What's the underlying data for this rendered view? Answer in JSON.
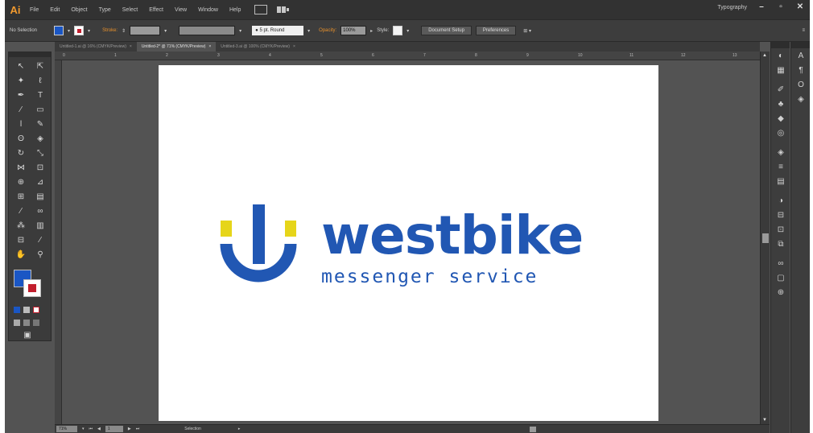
{
  "app": {
    "logo": "Ai"
  },
  "menu": [
    "File",
    "Edit",
    "Object",
    "Type",
    "Select",
    "Effect",
    "View",
    "Window",
    "Help"
  ],
  "workspace": "Typography",
  "window_buttons": {
    "minimize": "–",
    "restore": "▫",
    "close": "✕"
  },
  "control": {
    "selection": "No Selection",
    "stroke_label": "Stroke:",
    "brush": "5 pt. Round",
    "opacity_label": "Opacity:",
    "opacity_value": "100%",
    "style_label": "Style:",
    "document_setup": "Document Setup",
    "preferences": "Preferences"
  },
  "tabs": [
    {
      "label": "Untitled-1.ai @ 16% (CMYK/Preview)",
      "active": false
    },
    {
      "label": "Untitled-2* @ 71% (CMYK/Preview)",
      "active": true
    },
    {
      "label": "Untitled-3.ai @ 100% (CMYK/Preview)",
      "active": false
    }
  ],
  "ruler_ticks": [
    "0",
    "1",
    "2",
    "3",
    "4",
    "5",
    "6",
    "7",
    "8",
    "9",
    "10",
    "11",
    "12",
    "13"
  ],
  "logo": {
    "name": "westbike",
    "tagline": "messenger service",
    "brand_blue": "#2157b3",
    "brand_yellow": "#e6d51a"
  },
  "colors": {
    "fill": "#1a56c4",
    "stroke": "#c21f2e",
    "accent": "#f29a2e"
  },
  "status": {
    "zoom": "71%",
    "artboard": "1",
    "tool": "Selection"
  },
  "tools": [
    {
      "icon": "selection-icon",
      "glyph": "↖"
    },
    {
      "icon": "direct-selection-icon",
      "glyph": "⇱"
    },
    {
      "icon": "magic-wand-icon",
      "glyph": "✦"
    },
    {
      "icon": "lasso-icon",
      "glyph": "ℓ"
    },
    {
      "icon": "pen-icon",
      "glyph": "✒"
    },
    {
      "icon": "type-icon",
      "glyph": "T"
    },
    {
      "icon": "line-icon",
      "glyph": "⁄"
    },
    {
      "icon": "rectangle-icon",
      "glyph": "▭"
    },
    {
      "icon": "paintbrush-icon",
      "glyph": "ǀ"
    },
    {
      "icon": "pencil-icon",
      "glyph": "✎"
    },
    {
      "icon": "blob-brush-icon",
      "glyph": "ʘ"
    },
    {
      "icon": "eraser-icon",
      "glyph": "◈"
    },
    {
      "icon": "rotate-icon",
      "glyph": "↻"
    },
    {
      "icon": "scale-icon",
      "glyph": "⤡"
    },
    {
      "icon": "width-icon",
      "glyph": "⋈"
    },
    {
      "icon": "free-transform-icon",
      "glyph": "⊡"
    },
    {
      "icon": "shape-builder-icon",
      "glyph": "⊕"
    },
    {
      "icon": "perspective-icon",
      "glyph": "⊿"
    },
    {
      "icon": "mesh-icon",
      "glyph": "⊞"
    },
    {
      "icon": "gradient-icon",
      "glyph": "▤"
    },
    {
      "icon": "eyedropper-icon",
      "glyph": "⁄"
    },
    {
      "icon": "blend-icon",
      "glyph": "∞"
    },
    {
      "icon": "symbol-sprayer-icon",
      "glyph": "⁂"
    },
    {
      "icon": "column-graph-icon",
      "glyph": "▥"
    },
    {
      "icon": "artboard-icon",
      "glyph": "⊟"
    },
    {
      "icon": "slice-icon",
      "glyph": "∕"
    },
    {
      "icon": "hand-icon",
      "glyph": "✋"
    },
    {
      "icon": "zoom-icon",
      "glyph": "⚲"
    }
  ],
  "dock1": [
    "color-icon",
    "swatches-icon",
    "brushes-icon",
    "symbols-icon",
    "graphic-styles-icon",
    "appearance-icon",
    "layers-icon",
    "stroke-icon",
    "gradient-icon",
    "transparency-icon",
    "align-icon",
    "transform-icon",
    "pathfinder-icon",
    "links-icon",
    "artboards-icon",
    "navigator-icon"
  ],
  "dock2": [
    "character-icon",
    "paragraph-icon",
    "opentype-icon",
    "layers-icon"
  ]
}
